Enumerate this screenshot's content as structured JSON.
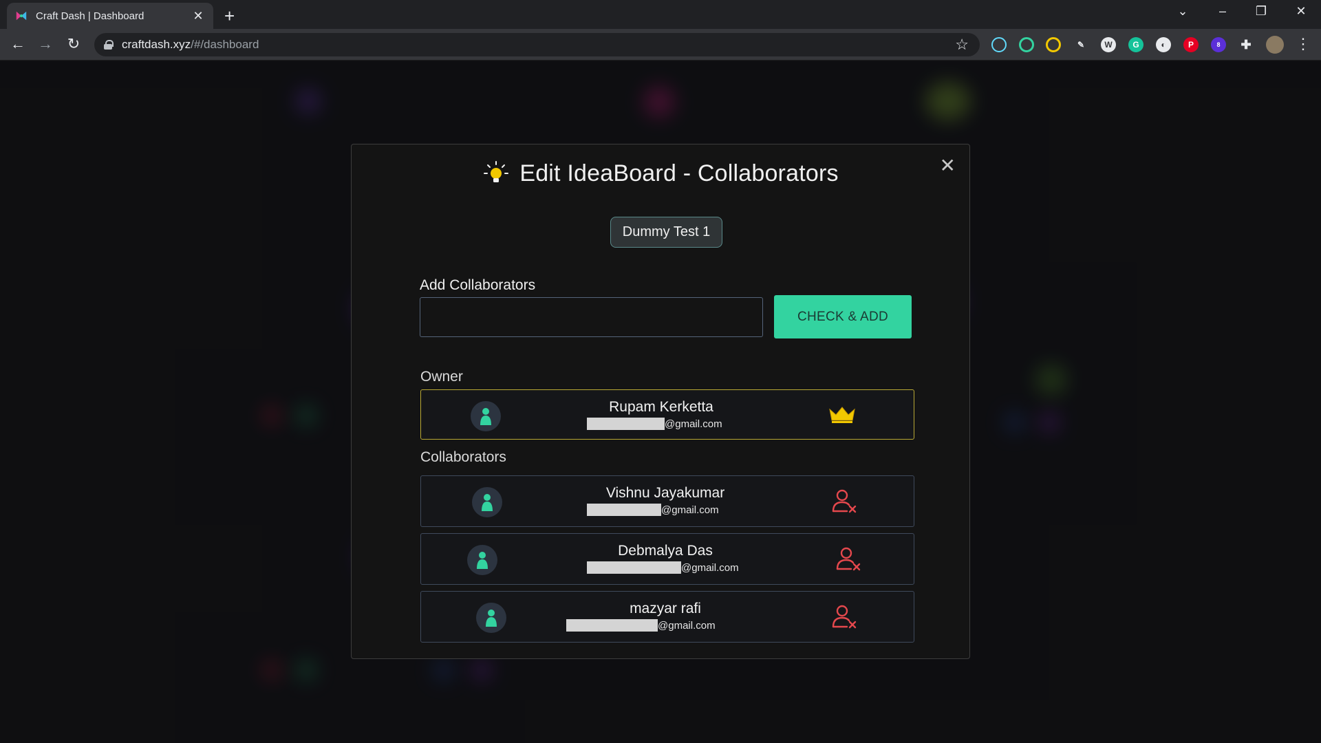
{
  "browser": {
    "tab_title": "Craft Dash | Dashboard",
    "tab_close": "✕",
    "new_tab": "+",
    "url_host": "craftdash.xyz",
    "url_path": "/#/dashboard",
    "minimize": "–",
    "restore": "❐",
    "close": "✕",
    "tab_search": "⌄",
    "back": "←",
    "forward": "→",
    "reload": "↻",
    "bookmark": "☆",
    "menu": "⋮",
    "extension_badge": "8"
  },
  "modal": {
    "title": "Edit IdeaBoard - Collaborators",
    "close": "✕",
    "board_name": "Dummy Test 1",
    "add_label": "Add Collaborators",
    "add_input_value": "",
    "add_button": "CHECK & ADD",
    "owner_label": "Owner",
    "collaborators_label": "Collaborators",
    "owner": {
      "name": "Rupam Kerketta",
      "email_suffix": "@gmail.com",
      "icon": "crown-icon"
    },
    "collaborators": [
      {
        "name": "Vishnu Jayakumar",
        "email_suffix": "@gmail.com",
        "icon": "remove-user-icon"
      },
      {
        "name": "Debmalya Das",
        "email_suffix": "@gmail.com",
        "icon": "remove-user-icon"
      },
      {
        "name": "mazyar rafi",
        "email_suffix": "@gmail.com",
        "icon": "remove-user-icon"
      }
    ]
  },
  "colors": {
    "accent": "#33d3a0",
    "owner_border": "#b9a935",
    "crown": "#f2c800",
    "remove": "#e5484d",
    "avatar_figure": "#33d3a0"
  }
}
